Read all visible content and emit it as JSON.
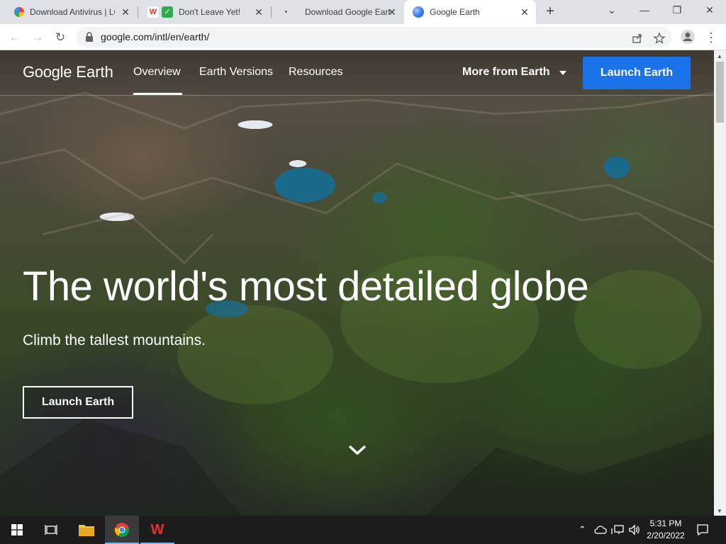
{
  "browser": {
    "tabs": [
      {
        "title": "Download Antivirus | LC",
        "icon": "colorful-logo-icon",
        "active": false
      },
      {
        "title": "Don't Leave Yet!",
        "icon": "wps-checkmark-icon",
        "active": false
      },
      {
        "title": "Download Google Eart",
        "icon": "loading-dot-icon",
        "active": false
      },
      {
        "title": "Google Earth",
        "icon": "google-earth-icon",
        "active": true
      }
    ],
    "new_tab": "+",
    "window_controls": {
      "chevron": "⌄",
      "minimize": "—",
      "restore": "❐",
      "close": "✕"
    },
    "url": "google.com/intl/en/earth/"
  },
  "earth_page": {
    "logo_google": "Google",
    "logo_earth": "Earth",
    "nav": {
      "overview": "Overview",
      "versions": "Earth Versions",
      "resources": "Resources",
      "more": "More from Earth",
      "launch": "Launch Earth"
    },
    "hero": {
      "title": "The world's most detailed globe",
      "subtitle": "Climb the tallest mountains.",
      "cta": "Launch Earth"
    }
  },
  "taskbar": {
    "clock_time": "5:31 PM",
    "clock_date": "2/20/2022"
  },
  "colors": {
    "accent_blue": "#1a73e8",
    "taskbar": "#1c1c1c"
  }
}
